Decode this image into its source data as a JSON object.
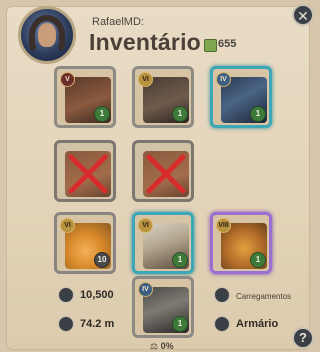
{
  "header": {
    "username": "RafaelMD:",
    "title": "Inventário",
    "silver": "655"
  },
  "slots": {
    "bag": {
      "tier": "V",
      "count": "1"
    },
    "helmet": {
      "tier": "VI",
      "count": "1"
    },
    "cape": {
      "tier": "IV",
      "count": "1"
    },
    "weapon_locked": {
      "count": ""
    },
    "offhand_locked": {
      "count": ""
    },
    "potion": {
      "tier": "VI",
      "count": "10"
    },
    "armor": {
      "tier": "VI",
      "count": "1"
    },
    "food": {
      "tier": "VIII",
      "count": "1"
    },
    "mount": {
      "tier": "IV",
      "count": "1"
    }
  },
  "bottom": {
    "fame": "10,500",
    "weight": "74.2 m",
    "loadouts_label": "Carregamentos",
    "wardrobe_label": "Armário",
    "weight_percent": "0%"
  },
  "colors": {
    "accent_green": "#3e7a3a",
    "rare_teal": "#3da7b8",
    "epic_purple": "#9b6ed2",
    "locked_red": "#d82b2b"
  }
}
